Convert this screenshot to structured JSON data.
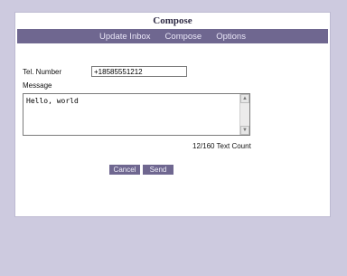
{
  "header": {
    "title": "Compose"
  },
  "nav": {
    "items": [
      "Update Inbox",
      "Compose",
      "Options"
    ]
  },
  "form": {
    "tel_label": "Tel. Number",
    "tel_value": "+18585551212",
    "message_label": "Message",
    "message_value": "Hello, world",
    "text_count": "12/160 Text Count"
  },
  "buttons": {
    "cancel": "Cancel",
    "send": "Send"
  },
  "icons": {
    "scroll_up": "arrow-up-icon",
    "scroll_down": "arrow-down-icon"
  },
  "colors": {
    "nav_bg": "#6f6790",
    "page_bg": "#cdcadf"
  }
}
